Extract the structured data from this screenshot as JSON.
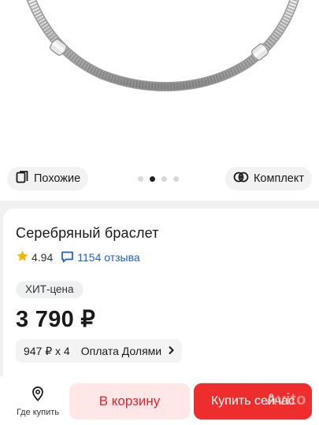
{
  "gallery": {
    "similar_label": "Похожие",
    "set_label": "Комплект",
    "dots_total": 4,
    "dots_active": 1
  },
  "product": {
    "title": "Серебряный браслет",
    "rating": "4.94",
    "reviews": "1154 отзыва",
    "hit_badge": "ХИТ-цена",
    "price": "3 790 ₽"
  },
  "installments": {
    "amount": "947 ₽ x 4",
    "label": "Оплата Долями"
  },
  "bottom_bar": {
    "where_to_buy": "Где купить",
    "cart_button": "В корзину",
    "buy_button": "Купить сейчас"
  },
  "watermark": "Avito",
  "colors": {
    "accent_red": "#ee2d2d",
    "cart_bg": "#ffe7e7",
    "link_blue": "#1f5fd6",
    "star": "#f6b500"
  },
  "icons": [
    "similar-icon",
    "set-icon",
    "star-icon",
    "chat-icon",
    "location-pin-icon",
    "chevron-right-icon"
  ]
}
